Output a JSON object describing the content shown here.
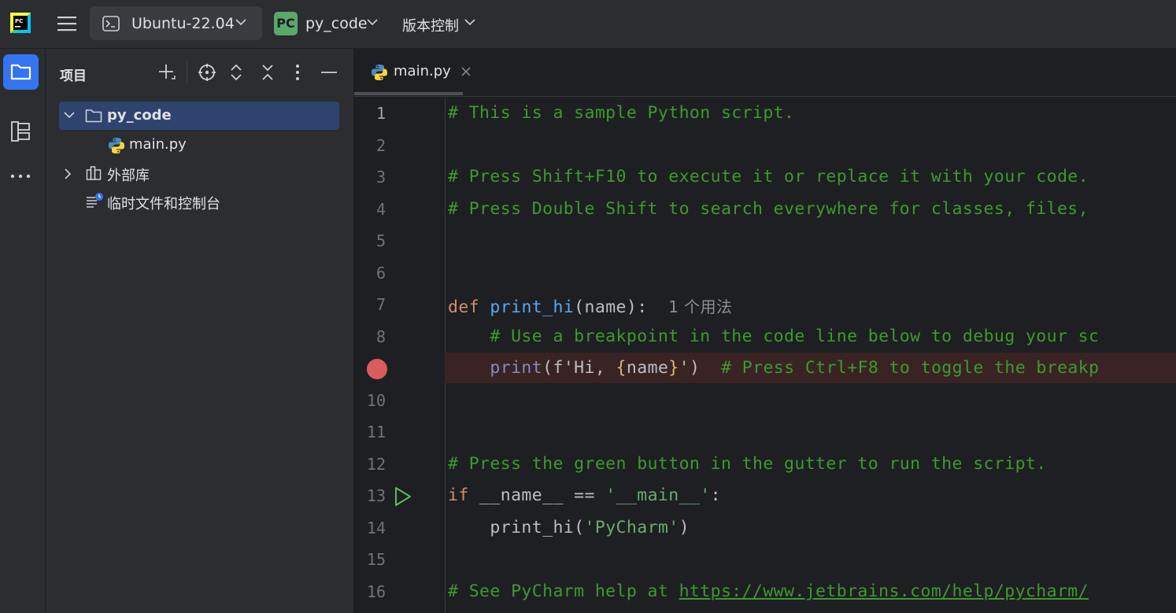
{
  "topbar": {
    "wsl_label": "Ubuntu-22.04",
    "project_badge": "PC",
    "project_name": "py_code",
    "vcs_label": "版本控制"
  },
  "project_panel": {
    "title": "项目",
    "root": "py_code",
    "file": "main.py",
    "external_libs": "外部库",
    "scratches": "临时文件和控制台"
  },
  "editor": {
    "tab_label": "main.py",
    "line_numbers": [
      "1",
      "2",
      "3",
      "4",
      "5",
      "6",
      "7",
      "8",
      "",
      "10",
      "11",
      "12",
      "13",
      "14",
      "15",
      "16"
    ],
    "lines": {
      "l1": "# This is a sample Python script.",
      "l3": "# Press Shift+F10 to execute it or replace it with your code.",
      "l4": "# Press Double Shift to search everywhere for classes, files,",
      "l7_kw": "def",
      "l7_fn": "print_hi",
      "l7_rest": "(name):",
      "l7_hint": "1 个用法",
      "l8": "# Use a breakpoint in the code line below to debug your sc",
      "l9_fn": "print",
      "l9_a": "(f'Hi, ",
      "l9_b": "{",
      "l9_c": "name",
      "l9_d": "}",
      "l9_e": "')",
      "l9_com": "# Press Ctrl+F8 to toggle the breakp",
      "l12": "# Press the green button in the gutter to run the script.",
      "l13_kw": "if",
      "l13_a": " __name__ == ",
      "l13_str": "'__main__'",
      "l13_b": ":",
      "l14_a": "print_hi(",
      "l14_str": "'PyCharm'",
      "l14_b": ")",
      "l16_com": "# See PyCharm help at ",
      "l16_url": "https://www.jetbrains.com/help/pycharm/"
    }
  },
  "colors": {
    "comment": "#3d9a2e",
    "keyword": "#cf8e6d",
    "function": "#56a8f5",
    "string": "#6aab73",
    "breakpoint": "#db5c5c",
    "selection": "#2e436e"
  }
}
